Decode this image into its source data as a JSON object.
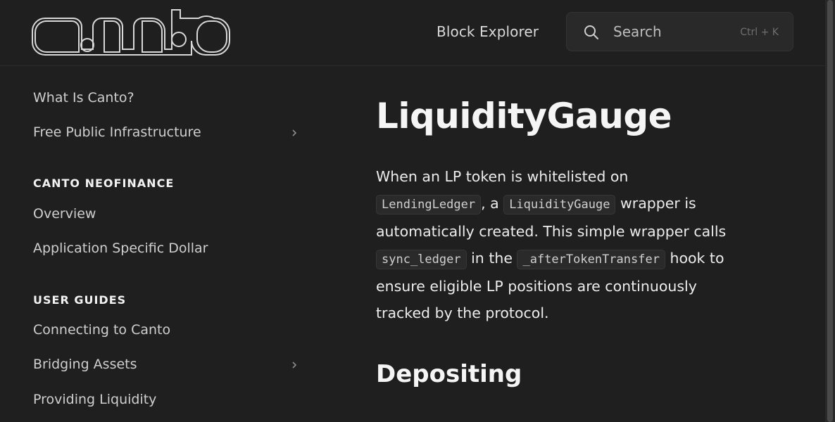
{
  "header": {
    "logo_text": "canto",
    "nav_link": "Block Explorer",
    "search": {
      "placeholder": "Search",
      "shortcut": "Ctrl + K",
      "icon": "search-icon"
    }
  },
  "sidebar": {
    "items": [
      {
        "label": "What Is Canto?"
      },
      {
        "label": "Free Public Infrastructure",
        "expandable": true
      }
    ],
    "sections": [
      {
        "heading": "CANTO NEOFINANCE",
        "items": [
          {
            "label": "Overview"
          },
          {
            "label": "Application Specific Dollar"
          }
        ]
      },
      {
        "heading": "USER GUIDES",
        "items": [
          {
            "label": "Connecting to Canto"
          },
          {
            "label": "Bridging Assets",
            "expandable": true
          },
          {
            "label": "Providing Liquidity"
          }
        ]
      }
    ]
  },
  "main": {
    "title": "LiquidityGauge",
    "intro": {
      "t1": "When an LP token is whitelisted on ",
      "c1": "LendingLedger",
      "t2": ", a ",
      "c2": "LiquidityGauge",
      "t3": " wrapper is automatically created. This simple wrapper calls ",
      "c3": "sync_ledger",
      "t4": " in the ",
      "c4": "_afterTokenTransfer",
      "t5": " hook to ensure eligible LP positions are continuously tracked by the protocol."
    },
    "section_heading": "Depositing"
  },
  "colors": {
    "background": "#1f1f1f",
    "text": "#e8e8e8",
    "code_background": "#2a2a2a"
  }
}
